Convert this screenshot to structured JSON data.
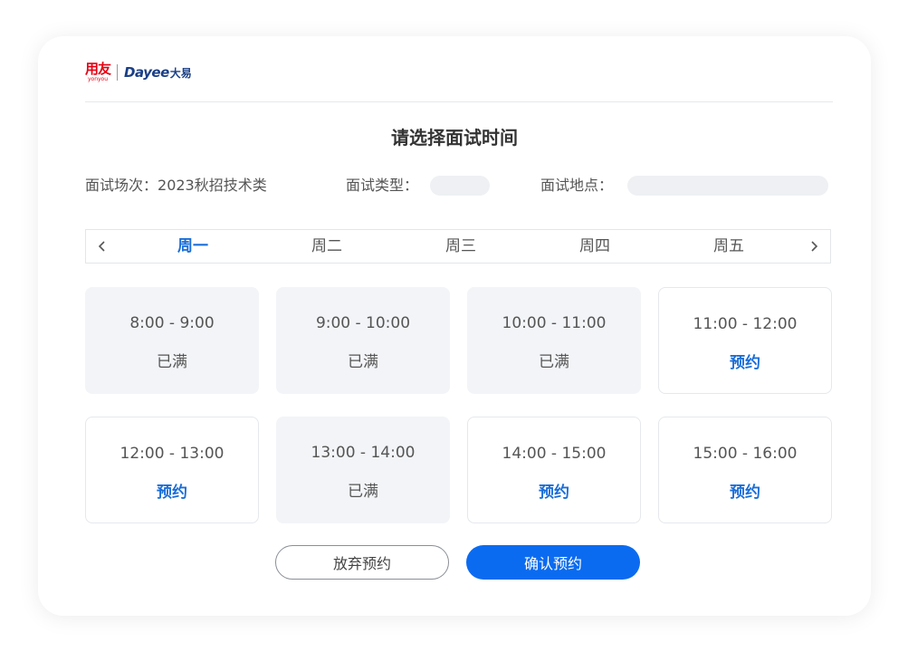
{
  "logo": {
    "yonyou_cn": "用友",
    "yonyou_en": "yonyou",
    "dayee_en": "Dayee",
    "dayee_cn": "大易"
  },
  "page": {
    "title": "请选择面试时间"
  },
  "info": {
    "session_label": "面试场次：",
    "session_value": "2023秋招技术类",
    "type_label": "面试类型：",
    "location_label": "面试地点："
  },
  "week": {
    "days": [
      {
        "label": "周一",
        "active": true
      },
      {
        "label": "周二",
        "active": false
      },
      {
        "label": "周三",
        "active": false
      },
      {
        "label": "周四",
        "active": false
      },
      {
        "label": "周五",
        "active": false
      }
    ],
    "prev_icon": "chevron-left-icon",
    "next_icon": "chevron-right-icon"
  },
  "slots": [
    {
      "time": "8:00 - 9:00",
      "status": "已满",
      "state": "full"
    },
    {
      "time": "9:00 - 10:00",
      "status": "已满",
      "state": "full"
    },
    {
      "time": "10:00 - 11:00",
      "status": "已满",
      "state": "full"
    },
    {
      "time": "11:00 - 12:00",
      "status": "预约",
      "state": "open"
    },
    {
      "time": "12:00 - 13:00",
      "status": "预约",
      "state": "open"
    },
    {
      "time": "13:00 - 14:00",
      "status": "已满",
      "state": "full"
    },
    {
      "time": "14:00 - 15:00",
      "status": "预约",
      "state": "open"
    },
    {
      "time": "15:00 - 16:00",
      "status": "预约",
      "state": "open"
    }
  ],
  "actions": {
    "cancel_label": "放弃预约",
    "confirm_label": "确认预约"
  },
  "colors": {
    "accent": "#1a6ed8",
    "confirm_button": "#0b6bf0",
    "full_slot_bg": "#f2f4f7",
    "yonyou_red": "#e60012",
    "dayee_blue": "#1a3f86"
  }
}
